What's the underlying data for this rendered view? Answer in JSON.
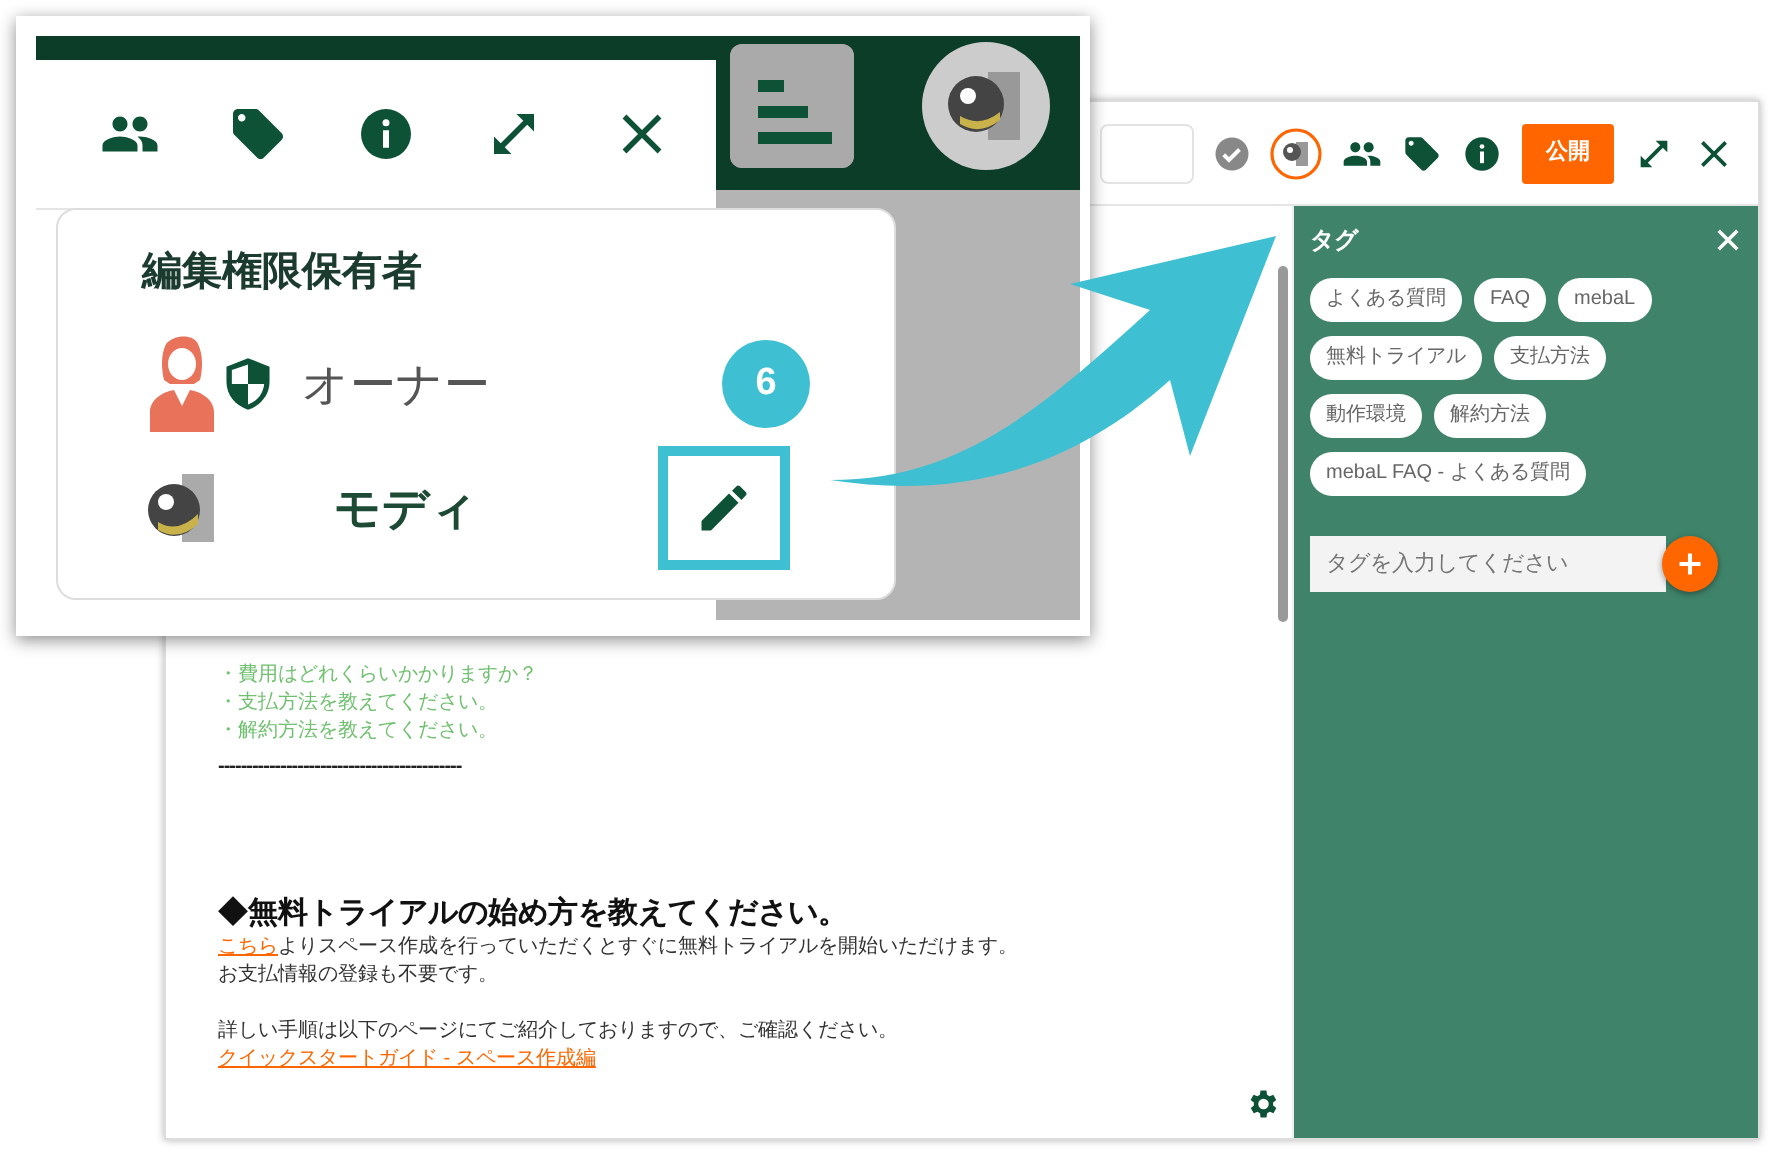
{
  "editor": {
    "publish_button": "公開",
    "lines": [
      {
        "kind": "bullet",
        "text": "・費用はどれくらいかかりますか？"
      },
      {
        "kind": "bullet",
        "text": "・支払方法を教えてください。"
      },
      {
        "kind": "bullet",
        "text": "・解約方法を教えてください。"
      },
      {
        "kind": "rule",
        "text": "-------------------------------------------"
      },
      {
        "kind": "heading",
        "text": "◆無料トライアルの始め方を教えてください。"
      },
      {
        "kind": "linked",
        "link": "こちら",
        "text": "よりスペース作成を行っていただくとすぐに無料トライアルを開始いただけます。"
      },
      {
        "kind": "para",
        "text": "お支払情報の登録も不要です。"
      },
      {
        "kind": "gap"
      },
      {
        "kind": "para",
        "text": "詳しい手順は以下のページにてご紹介しておりますので、ご確認ください。"
      },
      {
        "kind": "link",
        "text": "クイックスタートガイド - スペース作成編"
      }
    ]
  },
  "tag_panel": {
    "title": "タグ",
    "tags": [
      "よくある質問",
      "FAQ",
      "mebaL",
      "無料トライアル",
      "支払方法",
      "動作環境",
      "解約方法",
      "mebaL FAQ - よくある質問"
    ],
    "input": {
      "placeholder": "タグを入力してください"
    }
  },
  "callout": {
    "title": "編集権限保有者",
    "members": [
      {
        "kind": "owner",
        "name": "オーナー"
      },
      {
        "kind": "editor",
        "name": "モディ"
      }
    ],
    "step_badge": "6"
  }
}
